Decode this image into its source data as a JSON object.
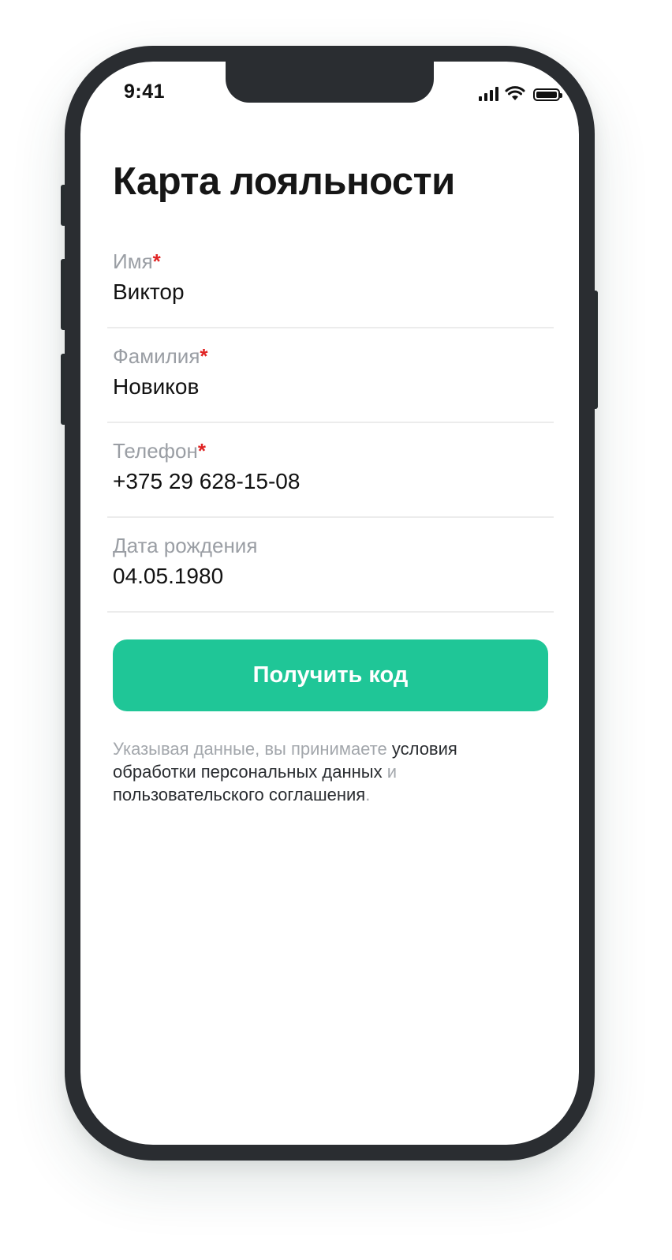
{
  "status_bar": {
    "time": "9:41",
    "icons": [
      "cellular-signal-icon",
      "wifi-icon",
      "battery-icon"
    ]
  },
  "page": {
    "title": "Карта лояльности"
  },
  "form": {
    "fields": [
      {
        "label": "Имя",
        "required_mark": "*",
        "value": "Виктор"
      },
      {
        "label": "Фамилия",
        "required_mark": "*",
        "value": "Новиков"
      },
      {
        "label": "Телефон",
        "required_mark": "*",
        "value": "+375 29 628-15-08"
      },
      {
        "label": "Дата рождения",
        "required_mark": "",
        "value": "04.05.1980"
      }
    ],
    "submit_label": "Получить код"
  },
  "terms": {
    "prefix": "Указывая данные, вы принимаете ",
    "link1": "условия обработки персональных данных",
    "middle": " и ",
    "link2": "пользовательского соглашения",
    "suffix": "."
  },
  "colors": {
    "accent": "#1fc697",
    "required": "#e02424",
    "device_frame": "#2a2d31",
    "label_gray": "#9a9ea4"
  }
}
